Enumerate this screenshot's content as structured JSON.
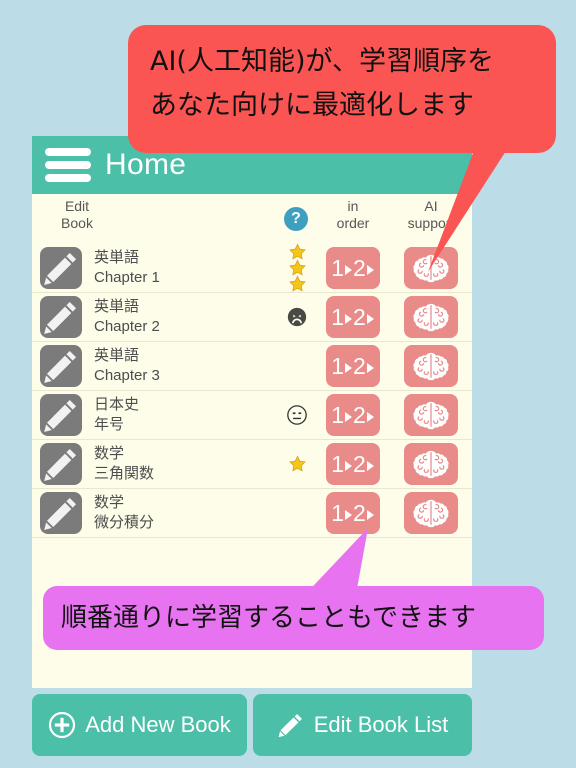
{
  "theme": {
    "page_background": "#bcdde8",
    "card_background": "#fdfdea",
    "header_teal": "#4bbfa8",
    "action_red": "#e88b89",
    "callout_red": "#fa5552",
    "callout_magenta": "#e873f0",
    "tile_gray": "#7b7b7b",
    "star_yellow": "#f5c518",
    "help_blue": "#3f9fbf"
  },
  "header": {
    "title": "Home",
    "menu_icon": "hamburger-icon"
  },
  "columns": {
    "edit_book_line1": "Edit",
    "edit_book_line2": "Book",
    "help_glyph": "?",
    "in_order_line1": "in",
    "in_order_line2": "order",
    "ai_support_line1": "AI",
    "ai_support_line2": "support"
  },
  "books": [
    {
      "title": "英単語",
      "subtitle": "Chapter 1",
      "status": "stars",
      "star_count": 3,
      "order_label": "1▸2▸",
      "ai_label": "brain-icon"
    },
    {
      "title": "英単語",
      "subtitle": "Chapter 2",
      "status": "frowning-face",
      "star_count": 0,
      "order_label": "1▸2▸",
      "ai_label": "brain-icon"
    },
    {
      "title": "英単語",
      "subtitle": "Chapter 3",
      "status": "none",
      "star_count": 0,
      "order_label": "1▸2▸",
      "ai_label": "brain-icon"
    },
    {
      "title": "日本史",
      "subtitle": "年号",
      "status": "neutral-face",
      "star_count": 0,
      "order_label": "1▸2▸",
      "ai_label": "brain-icon"
    },
    {
      "title": "数学",
      "subtitle": "三角関数",
      "status": "stars",
      "star_count": 1,
      "order_label": "1▸2▸",
      "ai_label": "brain-icon"
    },
    {
      "title": "数学",
      "subtitle": "微分積分",
      "status": "none",
      "star_count": 0,
      "order_label": "1▸2▸",
      "ai_label": "brain-icon"
    }
  ],
  "footer": {
    "add_new_book": "Add New Book",
    "edit_book_list": "Edit Book List",
    "add_icon": "plus-circle-icon",
    "edit_icon": "pencil-icon"
  },
  "callouts": {
    "ai": {
      "line1": "AI(人工知能)が、学習順序を",
      "line2": "あなた向けに最適化します"
    },
    "order": {
      "text": "順番通りに学習することもできます"
    }
  }
}
